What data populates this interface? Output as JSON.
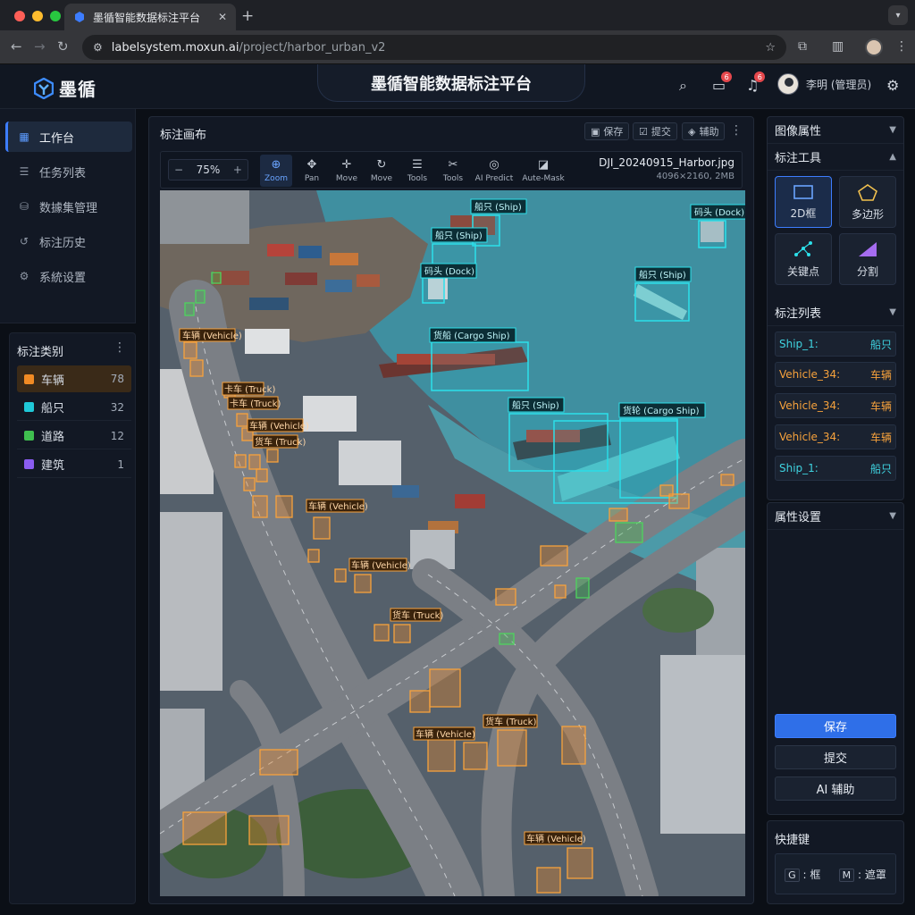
{
  "browser": {
    "tab_title": "墨循智能数据标注平台",
    "url_host": "labelsystem.moxun.ai",
    "url_path": "/project/harbor_urban_v2",
    "close_glyph": "✕",
    "new_tab_glyph": "+"
  },
  "header": {
    "logo_text": "墨循",
    "title": "墨循智能数据标注平台",
    "messages_badge": "6",
    "notifications_badge": "6",
    "user_name": "李明 (管理员)"
  },
  "sidebar": {
    "items": [
      {
        "label": "工作台",
        "icon": "grid-icon"
      },
      {
        "label": "任务列表",
        "icon": "list-icon"
      },
      {
        "label": "数據集管理",
        "icon": "database-icon"
      },
      {
        "label": "标注历史",
        "icon": "history-icon"
      },
      {
        "label": "系統设置",
        "icon": "gear-icon"
      }
    ]
  },
  "categories": {
    "title": "标注类别",
    "items": [
      {
        "name": "车辆",
        "count": "78",
        "color": "#f08a24"
      },
      {
        "name": "船只",
        "count": "32",
        "color": "#1fc8d8"
      },
      {
        "name": "道路",
        "count": "12",
        "color": "#3fbf4f"
      },
      {
        "name": "建筑",
        "count": "1",
        "color": "#8a5cf0"
      }
    ]
  },
  "canvas": {
    "title": "标注画布",
    "save": "保存",
    "submit": "提交",
    "assist": "辅助",
    "zoom_value": "75%",
    "zoom_minus": "−",
    "zoom_plus": "+",
    "tools": [
      {
        "label": "Zoom",
        "icon": "zoom-icon",
        "glyph": "⊕"
      },
      {
        "label": "Pan",
        "icon": "pan-icon",
        "glyph": "✥"
      },
      {
        "label": "Move",
        "icon": "move-icon",
        "glyph": "✛"
      },
      {
        "label": "Move",
        "icon": "redo-icon",
        "glyph": "↻"
      },
      {
        "label": "Tools",
        "icon": "sliders-icon",
        "glyph": "☰"
      },
      {
        "label": "Tools",
        "icon": "wand-icon",
        "glyph": "✂"
      },
      {
        "label": "AI Predict",
        "icon": "ai-icon",
        "glyph": "◎"
      },
      {
        "label": "Aute-Mask",
        "icon": "mask-icon",
        "glyph": "◪"
      }
    ],
    "file_name": "DJI_20240915_Harbor.jpg",
    "file_meta": "4096×2160,  2MB",
    "labels": {
      "ship_top": "船只 (Ship)",
      "dock_top_right": "码头 (Dock)",
      "ship_mid_left": "船只 (Ship)",
      "dock_mid": "码头 (Dock)",
      "ship_right": "船只 (Ship)",
      "cargo_ship_1": "货船 (Cargo Ship)",
      "ship_lower": "船只 (Ship)",
      "cargo_ship_2": "货轮 (Cargo Ship)",
      "veh_1": "车辆 (Vehicle)",
      "veh_2": "卡车 (Truck)",
      "veh_3": "卡车 (Truck)",
      "veh_4": "车辆 (Vehicle)",
      "veh_5": "货车 (Truck)",
      "veh_6": "车辆 (Vehicle)",
      "veh_7": "车辆 (Vehicle)",
      "veh_8": "货车 (Truck)",
      "veh_9": "货车 (Truck)",
      "veh_10": "车辆 (Vehicle)",
      "veh_11": "车辆 (Vehicle)"
    }
  },
  "right_panel": {
    "image_props": "图像属性",
    "tools_title": "标注工具",
    "tool_tiles": [
      {
        "label": "2D框",
        "icon": "bbox-icon"
      },
      {
        "label": "多边形",
        "icon": "polygon-icon"
      },
      {
        "label": "关键点",
        "icon": "keypoint-icon"
      },
      {
        "label": "分割",
        "icon": "segment-icon"
      }
    ],
    "list_title": "标注列表",
    "list_items": [
      {
        "name": "Ship_1:",
        "cls": "船只",
        "color": "#1fc8d8"
      },
      {
        "name": "Vehicle_34:",
        "cls": "车辆",
        "color": "#f08a24"
      },
      {
        "name": "Vehicle_34:",
        "cls": "车辆",
        "color": "#f08a24"
      },
      {
        "name": "Vehicle_34:",
        "cls": "车辆",
        "color": "#f08a24"
      },
      {
        "name": "Ship_1:",
        "cls": "船只",
        "color": "#1fc8d8"
      }
    ],
    "props_title": "属性设置",
    "save_button": "保存",
    "submit_button": "提交",
    "ai_button": "AI 辅助",
    "shortcuts_title": "快捷键",
    "shortcut_g_key": "G",
    "shortcut_g_label": "框",
    "shortcut_m_key": "M",
    "shortcut_m_label": "遮罩"
  }
}
